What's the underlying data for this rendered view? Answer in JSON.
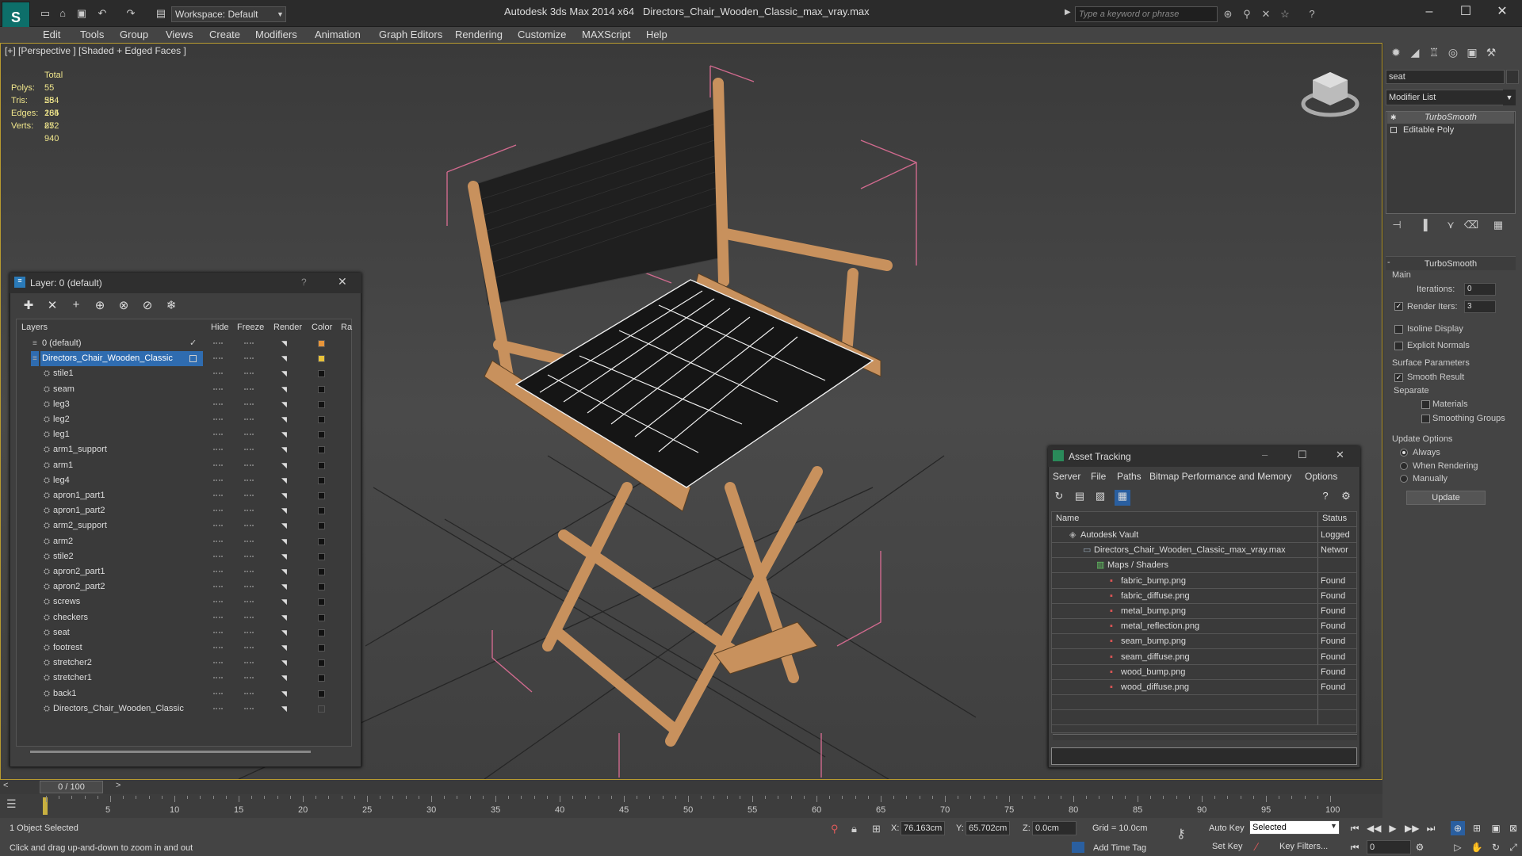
{
  "titlebar": {
    "workspace": "Workspace: Default",
    "app_title": "Autodesk 3ds Max  2014 x64",
    "doc_title": "Directors_Chair_Wooden_Classic_max_vray.max",
    "search_placeholder": "Type a keyword or phrase"
  },
  "menu": [
    "Edit",
    "Tools",
    "Group",
    "Views",
    "Create",
    "Modifiers",
    "Animation",
    "Graph Editors",
    "Rendering",
    "Customize",
    "MAXScript",
    "Help"
  ],
  "viewport": {
    "label": "[+] [Perspective ] [Shaded + Edged Faces ]",
    "stats": {
      "header": "Total",
      "rows": [
        {
          "label": "Polys:",
          "value": "55 284"
        },
        {
          "label": "Tris:",
          "value": "55 284"
        },
        {
          "label": "Edges:",
          "value": "165 852"
        },
        {
          "label": "Verts:",
          "value": "27 940"
        }
      ]
    }
  },
  "command_panel": {
    "object_name": "seat",
    "modifier_list": "Modifier List",
    "stack": [
      "TurboSmooth",
      "Editable Poly"
    ],
    "rollout_title": "TurboSmooth",
    "main_label": "Main",
    "iterations_label": "Iterations:",
    "iterations_value": "0",
    "render_iters_label": "Render Iters:",
    "render_iters_value": "3",
    "isoline": "Isoline Display",
    "explicit_normals": "Explicit Normals",
    "surface_params": "Surface Parameters",
    "smooth_result": "Smooth Result",
    "separate": "Separate",
    "materials": "Materials",
    "smoothing_groups": "Smoothing Groups",
    "update_options": "Update Options",
    "always": "Always",
    "when_rendering": "When Rendering",
    "manually": "Manually",
    "update_btn": "Update"
  },
  "layer_window": {
    "title": "Layer: 0 (default)",
    "help": "?",
    "columns": [
      "Layers",
      "Hide",
      "Freeze",
      "Render",
      "Color",
      "Ra"
    ],
    "rows": [
      {
        "name": "0 (default)",
        "indent": 1,
        "color": "#e8953a",
        "check": "✓"
      },
      {
        "name": "Directors_Chair_Wooden_Classic",
        "indent": 1,
        "color": "#e8c23a",
        "selected": true
      },
      {
        "name": "stile1",
        "indent": 2,
        "color": "#111111"
      },
      {
        "name": "seam",
        "indent": 2,
        "color": "#111111"
      },
      {
        "name": "leg3",
        "indent": 2,
        "color": "#111111"
      },
      {
        "name": "leg2",
        "indent": 2,
        "color": "#111111"
      },
      {
        "name": "leg1",
        "indent": 2,
        "color": "#111111"
      },
      {
        "name": "arm1_support",
        "indent": 2,
        "color": "#111111"
      },
      {
        "name": "arm1",
        "indent": 2,
        "color": "#111111"
      },
      {
        "name": "leg4",
        "indent": 2,
        "color": "#111111"
      },
      {
        "name": "apron1_part1",
        "indent": 2,
        "color": "#111111"
      },
      {
        "name": "apron1_part2",
        "indent": 2,
        "color": "#111111"
      },
      {
        "name": "arm2_support",
        "indent": 2,
        "color": "#111111"
      },
      {
        "name": "arm2",
        "indent": 2,
        "color": "#111111"
      },
      {
        "name": "stile2",
        "indent": 2,
        "color": "#111111"
      },
      {
        "name": "apron2_part1",
        "indent": 2,
        "color": "#111111"
      },
      {
        "name": "apron2_part2",
        "indent": 2,
        "color": "#111111"
      },
      {
        "name": "screws",
        "indent": 2,
        "color": "#111111"
      },
      {
        "name": "checkers",
        "indent": 2,
        "color": "#111111"
      },
      {
        "name": "seat",
        "indent": 2,
        "color": "#111111"
      },
      {
        "name": "footrest",
        "indent": 2,
        "color": "#111111"
      },
      {
        "name": "stretcher2",
        "indent": 2,
        "color": "#111111"
      },
      {
        "name": "stretcher1",
        "indent": 2,
        "color": "#111111"
      },
      {
        "name": "back1",
        "indent": 2,
        "color": "#111111"
      },
      {
        "name": "Directors_Chair_Wooden_Classic",
        "indent": 2,
        "color": "#3a3a3a"
      }
    ]
  },
  "asset_window": {
    "title": "Asset Tracking",
    "menu": [
      "Server",
      "File",
      "Paths",
      "Bitmap Performance and Memory",
      "Options"
    ],
    "columns": [
      "Name",
      "Status"
    ],
    "rows": [
      {
        "name": "Autodesk Vault",
        "status": "Logged",
        "indent": 1
      },
      {
        "name": "Directors_Chair_Wooden_Classic_max_vray.max",
        "status": "Networ",
        "indent": 2
      },
      {
        "name": "Maps / Shaders",
        "status": "",
        "indent": 3
      },
      {
        "name": "fabric_bump.png",
        "status": "Found",
        "indent": 4
      },
      {
        "name": "fabric_diffuse.png",
        "status": "Found",
        "indent": 4
      },
      {
        "name": "metal_bump.png",
        "status": "Found",
        "indent": 4
      },
      {
        "name": "metal_reflection.png",
        "status": "Found",
        "indent": 4
      },
      {
        "name": "seam_bump.png",
        "status": "Found",
        "indent": 4
      },
      {
        "name": "seam_diffuse.png",
        "status": "Found",
        "indent": 4
      },
      {
        "name": "wood_bump.png",
        "status": "Found",
        "indent": 4
      },
      {
        "name": "wood_diffuse.png",
        "status": "Found",
        "indent": 4
      }
    ]
  },
  "timeline": {
    "frame": "0 / 100",
    "ticks": [
      "5",
      "10",
      "15",
      "20",
      "25",
      "30",
      "35",
      "40",
      "45",
      "50",
      "55",
      "60",
      "65",
      "70",
      "75",
      "80",
      "85",
      "90",
      "95",
      "100"
    ]
  },
  "statusbar": {
    "selected": "1 Object Selected",
    "hint": "Click and drag up-and-down to zoom in and out",
    "x_label": "X:",
    "x_value": "76.163cm",
    "y_label": "Y:",
    "y_value": "65.702cm",
    "z_label": "Z:",
    "z_value": "0.0cm",
    "grid": "Grid = 10.0cm",
    "add_time_tag": "Add Time Tag",
    "auto_key": "Auto Key",
    "set_key": "Set Key",
    "selected_dropdown": "Selected",
    "key_filters": "Key Filters...",
    "frame_field": "0"
  }
}
